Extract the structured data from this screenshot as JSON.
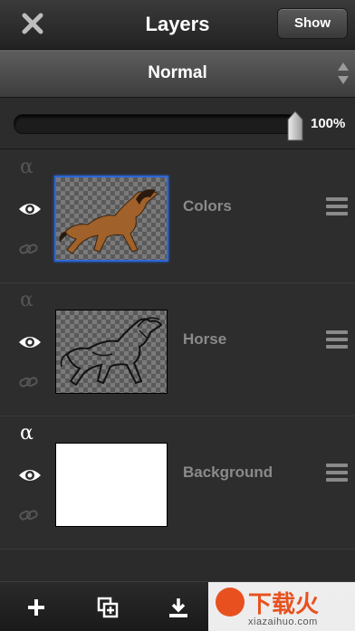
{
  "header": {
    "title": "Layers",
    "show_label": "Show"
  },
  "blend": {
    "mode": "Normal"
  },
  "opacity": {
    "value": 1.0,
    "label": "100%"
  },
  "layers": [
    {
      "name": "Colors",
      "alpha": "α",
      "alpha_locked": false,
      "visible": true,
      "selected": true,
      "content": "brown horse painting"
    },
    {
      "name": "Horse",
      "alpha": "α",
      "alpha_locked": false,
      "visible": true,
      "selected": false,
      "content": "horse sketch"
    },
    {
      "name": "Background",
      "alpha": "α",
      "alpha_locked": true,
      "visible": true,
      "selected": false,
      "content": "white"
    }
  ],
  "toolbar": {
    "icons": [
      "add-icon",
      "duplicate-layer-icon",
      "download-icon"
    ]
  },
  "watermark": {
    "text": "下载火",
    "url": "xiazaihuo.com"
  },
  "colors": {
    "selection": "#2b67d8",
    "brand": "#e8511f"
  }
}
